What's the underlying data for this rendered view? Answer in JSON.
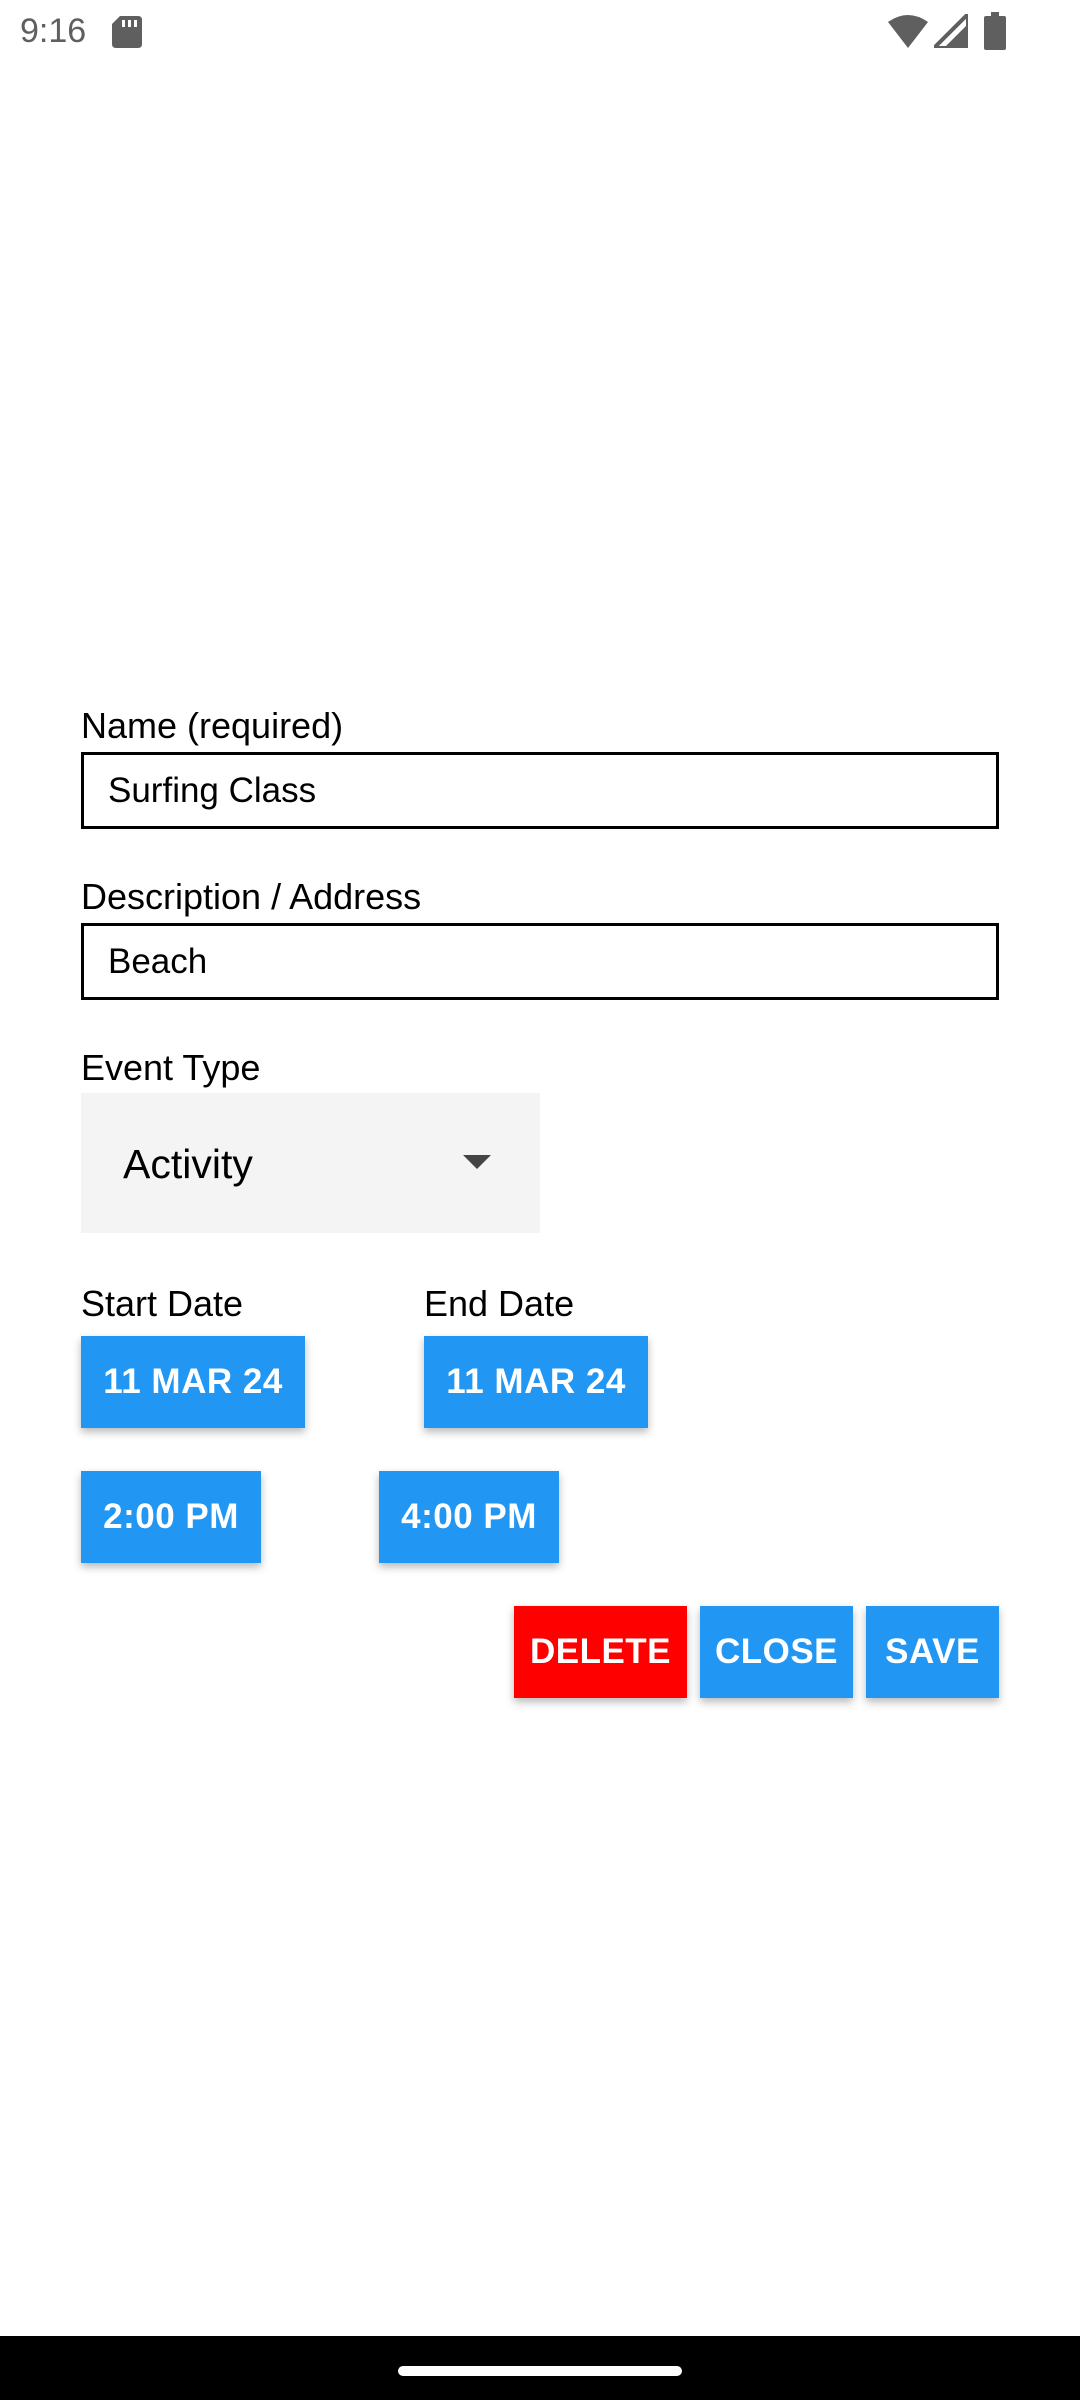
{
  "status_bar": {
    "time": "9:16",
    "icons": [
      "sd-card-icon",
      "wifi-icon",
      "signal-icon",
      "battery-icon"
    ]
  },
  "form": {
    "name_label": "Name (required)",
    "name_value": "Surfing Class",
    "description_label": "Description / Address",
    "description_value": "Beach",
    "event_type_label": "Event Type",
    "event_type_value": "Activity",
    "start_date_label": "Start Date",
    "end_date_label": "End Date",
    "start_date": "11 MAR 24",
    "end_date": "11 MAR 24",
    "start_time": "2:00 PM",
    "end_time": "4:00 PM"
  },
  "actions": {
    "delete_label": "DELETE",
    "close_label": "CLOSE",
    "save_label": "SAVE"
  },
  "colors": {
    "primary_button": "#2196f3",
    "delete_button": "#ff0000",
    "dropdown_background": "#f4f4f4"
  }
}
